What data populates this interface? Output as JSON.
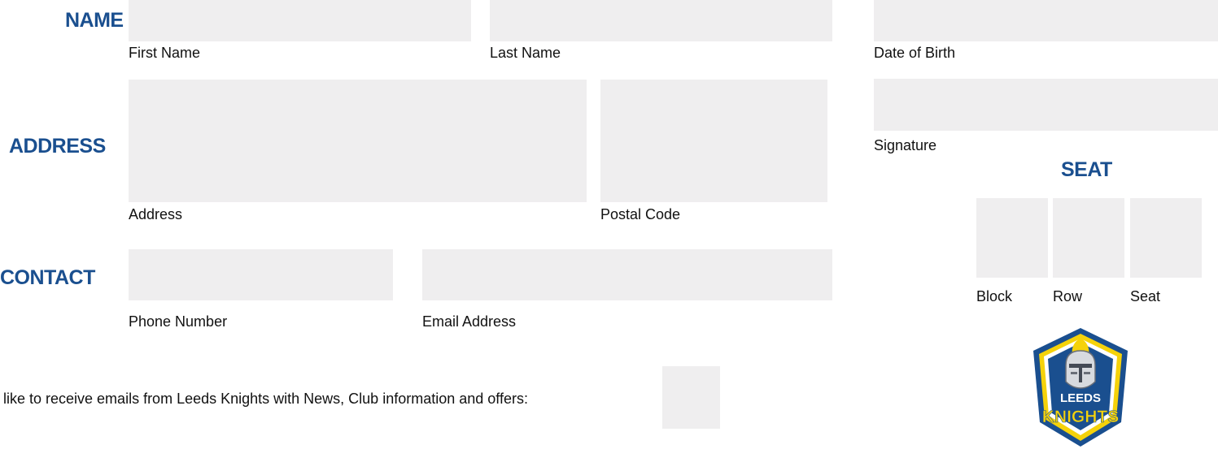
{
  "headings": {
    "name": "NAME",
    "address": "ADDRESS",
    "contact": "CONTACT",
    "seat": "SEAT"
  },
  "fields": {
    "first_name": {
      "label": "First Name",
      "value": ""
    },
    "last_name": {
      "label": "Last Name",
      "value": ""
    },
    "date_of_birth": {
      "label": "Date of Birth",
      "value": ""
    },
    "address": {
      "label": "Address",
      "value": ""
    },
    "postal_code": {
      "label": "Postal Code",
      "value": ""
    },
    "signature": {
      "label": "Signature",
      "value": ""
    },
    "phone_number": {
      "label": "Phone Number",
      "value": ""
    },
    "email_address": {
      "label": "Email Address",
      "value": ""
    },
    "block": {
      "label": "Block",
      "value": ""
    },
    "row": {
      "label": "Row",
      "value": ""
    },
    "seat": {
      "label": "Seat",
      "value": ""
    }
  },
  "consent": {
    "text": "like to receive emails from Leeds Knights with News, Club information and offers:",
    "checked": false
  },
  "logo": {
    "icon": "knight-helmet-shield-icon",
    "line1": "LEEDS",
    "line2": "KNIGHTS"
  },
  "colors": {
    "heading": "#1a4f8f",
    "field_background": "#efeeef",
    "logo_blue": "#1a4f8f",
    "logo_yellow": "#f5d20a"
  }
}
